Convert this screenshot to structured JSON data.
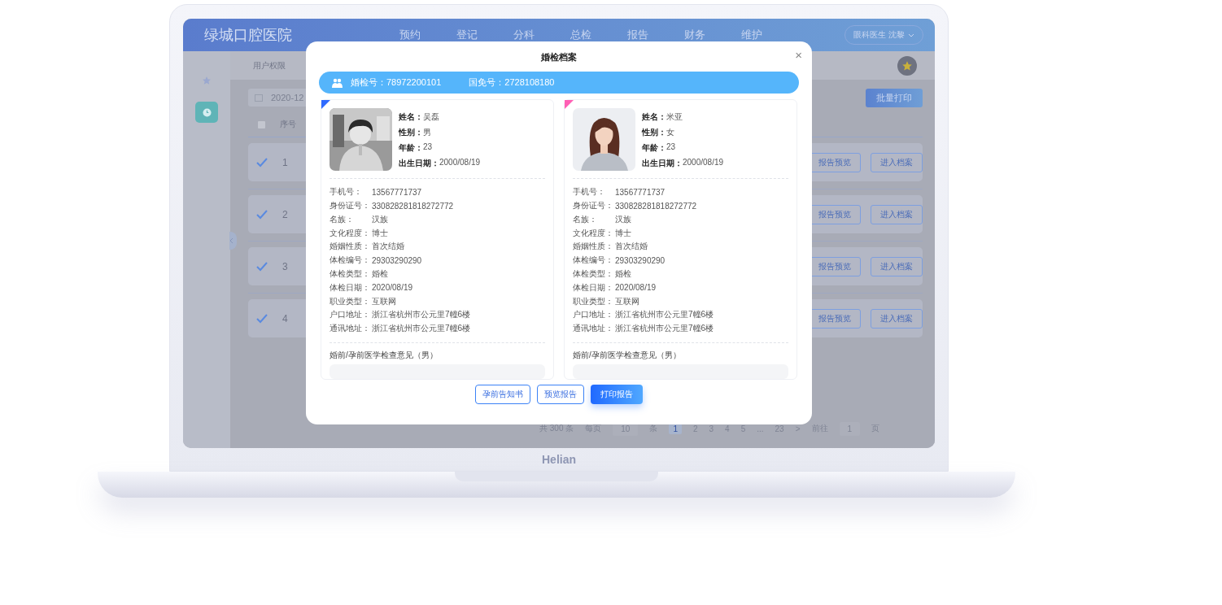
{
  "header": {
    "logo": "绿城口腔医院",
    "nav": [
      {
        "label": "预约",
        "selected": false
      },
      {
        "label": "登记",
        "selected": false
      },
      {
        "label": "分科",
        "selected": false
      },
      {
        "label": "总检",
        "selected": false
      },
      {
        "label": "报告",
        "selected": false
      },
      {
        "label": "财务",
        "selected": false
      },
      {
        "label": "维护",
        "selected": false
      }
    ],
    "user": "眼科医生 沈黎"
  },
  "breadcrumb": "用户权限",
  "toolbar": {
    "date_field": "2020-12",
    "batch_button": "批量打印"
  },
  "table": {
    "header": {
      "index": "序号",
      "checked": false
    },
    "rows": [
      {
        "index": "1",
        "checked": true,
        "actions": [
          "报告预览",
          "进入档案"
        ]
      },
      {
        "index": "2",
        "checked": true,
        "actions": [
          "报告预览",
          "进入档案"
        ]
      },
      {
        "index": "3",
        "checked": true,
        "actions": [
          "报告预览",
          "进入档案"
        ]
      },
      {
        "index": "4",
        "checked": true,
        "actions": [
          "报告预览",
          "进入档案"
        ]
      }
    ]
  },
  "pagination": {
    "total": "共 300 条",
    "per_page_label": "每页",
    "per_page": "10",
    "per_page_unit": "条",
    "pages": [
      {
        "label": "1",
        "selected": true
      },
      {
        "label": "2",
        "selected": false
      },
      {
        "label": "3",
        "selected": false
      },
      {
        "label": "4",
        "selected": false
      },
      {
        "label": "5",
        "selected": false
      },
      {
        "label": "...",
        "selected": false
      },
      {
        "label": "23",
        "selected": false
      }
    ],
    "next": ">",
    "goto_label": "前往",
    "goto_value": "1",
    "goto_unit": "页"
  },
  "modal": {
    "title": "婚检档案",
    "close": "×",
    "banner": [
      {
        "label": "婚检号：",
        "value": "78972200101"
      },
      {
        "label": "国免号：",
        "value": "2728108180"
      }
    ],
    "cards": [
      {
        "color": "#2f6bff",
        "info": [
          {
            "label": "姓名：",
            "value": "吴磊"
          },
          {
            "label": "性别：",
            "value": "男"
          },
          {
            "label": "年龄：",
            "value": "23"
          },
          {
            "label": "出生日期：",
            "value": "2000/08/19"
          }
        ],
        "fields": [
          {
            "label": "手机号：",
            "value": "13567771737"
          },
          {
            "label": "身份证号：",
            "value": "330828281818272772"
          },
          {
            "label": "名族：",
            "value": "汉族"
          },
          {
            "label": "文化程度：",
            "value": "博士"
          },
          {
            "label": "婚姻性质：",
            "value": "首次结婚"
          },
          {
            "label": "体检编号：",
            "value": "29303290290"
          },
          {
            "label": "体检类型：",
            "value": "婚检"
          },
          {
            "label": "体检日期：",
            "value": "2020/08/19"
          },
          {
            "label": "职业类型：",
            "value": "互联网"
          },
          {
            "label": "户口地址：",
            "value": "浙江省杭州市公元里7幢6楼"
          },
          {
            "label": "通讯地址：",
            "value": "浙江省杭州市公元里7幢6楼"
          }
        ],
        "opinion_title": "婚前/孕前医学检查意见（男）"
      },
      {
        "color": "#ff5fb4",
        "info": [
          {
            "label": "姓名：",
            "value": "米亚"
          },
          {
            "label": "性别：",
            "value": "女"
          },
          {
            "label": "年龄：",
            "value": "23"
          },
          {
            "label": "出生日期：",
            "value": "2000/08/19"
          }
        ],
        "fields": [
          {
            "label": "手机号：",
            "value": "13567771737"
          },
          {
            "label": "身份证号：",
            "value": "330828281818272772"
          },
          {
            "label": "名族：",
            "value": "汉族"
          },
          {
            "label": "文化程度：",
            "value": "博士"
          },
          {
            "label": "婚姻性质：",
            "value": "首次结婚"
          },
          {
            "label": "体检编号：",
            "value": "29303290290"
          },
          {
            "label": "体检类型：",
            "value": "婚检"
          },
          {
            "label": "体检日期：",
            "value": "2020/08/19"
          },
          {
            "label": "职业类型：",
            "value": "互联网"
          },
          {
            "label": "户口地址：",
            "value": "浙江省杭州市公元里7幢6楼"
          },
          {
            "label": "通讯地址：",
            "value": "浙江省杭州市公元里7幢6楼"
          }
        ],
        "opinion_title": "婚前/孕前医学检查意见（男）"
      }
    ],
    "buttons": [
      {
        "label": "孕前告知书",
        "kind": "outline"
      },
      {
        "label": "预览报告",
        "kind": "outline"
      },
      {
        "label": "打印报告",
        "kind": "primary"
      }
    ]
  },
  "brand": "Helian"
}
